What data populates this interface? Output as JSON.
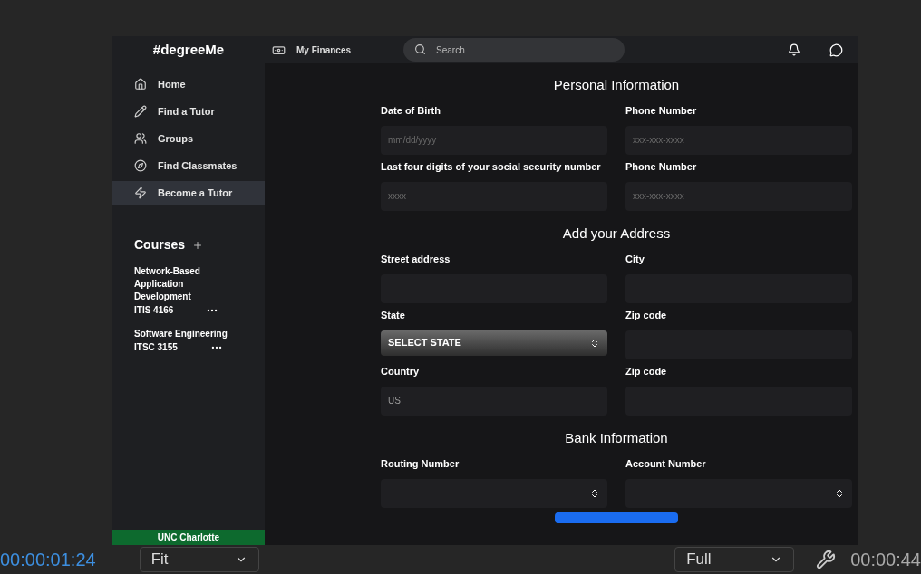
{
  "app": {
    "logo": "#degreeMe",
    "nav_link": "My Finances",
    "search": {
      "placeholder": "Search"
    },
    "sidebar": {
      "items": [
        {
          "label": "Home",
          "selected": false
        },
        {
          "label": "Find a Tutor",
          "selected": false
        },
        {
          "label": "Groups",
          "selected": false
        },
        {
          "label": "Find Classmates",
          "selected": false
        },
        {
          "label": "Become a Tutor",
          "selected": true
        }
      ],
      "courses_title": "Courses",
      "courses": [
        {
          "name": "Network-Based Application Development",
          "code": "ITIS 4166"
        },
        {
          "name": "Software Engineering",
          "code": "ITSC 3155"
        }
      ],
      "footer": "UNC Charlotte"
    },
    "form": {
      "sections": [
        {
          "title": "Personal Information",
          "left": [
            {
              "label": "Date of Birth",
              "kind": "text",
              "placeholder": "mm/dd/yyyy"
            },
            {
              "label": "Last four digits of your social security number",
              "kind": "text",
              "placeholder": "xxxx"
            }
          ],
          "right": [
            {
              "label": "Phone Number",
              "kind": "text",
              "placeholder": "xxx-xxx-xxxx"
            },
            {
              "label": "Phone Number",
              "kind": "text",
              "placeholder": "xxx-xxx-xxxx"
            }
          ]
        },
        {
          "title": "Add your Address",
          "left": [
            {
              "label": "Street address",
              "kind": "text"
            },
            {
              "label": "State",
              "kind": "select",
              "value": "SELECT STATE"
            },
            {
              "label": "Country",
              "kind": "text",
              "value": "US"
            }
          ],
          "right": [
            {
              "label": "City",
              "kind": "text"
            },
            {
              "label": "Zip code",
              "kind": "text"
            },
            {
              "label": "Zip code",
              "kind": "text"
            }
          ]
        },
        {
          "title": "Bank Information",
          "left": [
            {
              "label": "Routing Number",
              "kind": "number"
            }
          ],
          "right": [
            {
              "label": "Account Number",
              "kind": "number"
            }
          ]
        }
      ]
    }
  },
  "player": {
    "timecode": "00:00:01:24",
    "zoom": "Fit",
    "resolution": "Full",
    "duration": "00:00:44"
  }
}
